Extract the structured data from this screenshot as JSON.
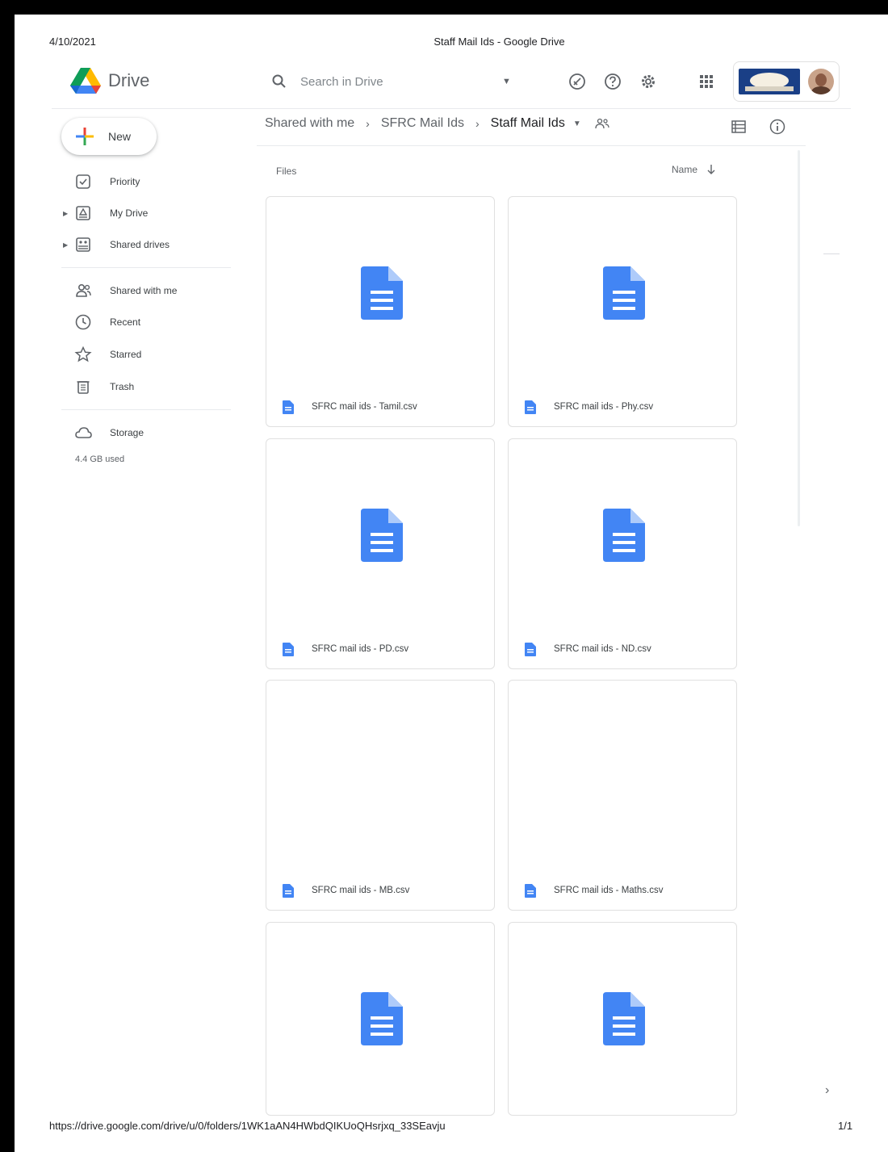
{
  "print": {
    "date": "4/10/2021",
    "title": "Staff Mail Ids - Google Drive",
    "url": "https://drive.google.com/drive/u/0/folders/1WK1aAN4HWbdQIKUoQHsrjxq_33SEavju",
    "page": "1/1"
  },
  "app": {
    "name": "Drive"
  },
  "search": {
    "placeholder": "Search in Drive"
  },
  "new_button": {
    "label": "New"
  },
  "sidebar": {
    "items": [
      {
        "label": "Priority",
        "icon": "priority-checkbox-icon"
      },
      {
        "label": "My Drive",
        "icon": "my-drive-icon"
      },
      {
        "label": "Shared drives",
        "icon": "shared-drives-icon"
      },
      {
        "label": "Shared with me",
        "icon": "shared-with-me-icon"
      },
      {
        "label": "Recent",
        "icon": "clock-icon"
      },
      {
        "label": "Starred",
        "icon": "star-icon"
      },
      {
        "label": "Trash",
        "icon": "trash-icon"
      },
      {
        "label": "Storage",
        "icon": "cloud-icon"
      }
    ],
    "storage_used": "4.4 GB used"
  },
  "breadcrumb": [
    "Shared with me",
    "SFRC Mail Ids",
    "Staff Mail Ids"
  ],
  "files_header": {
    "label": "Files",
    "sort_label": "Name"
  },
  "files": [
    {
      "name": "SFRC mail ids - Tamil.csv",
      "has_thumb": true
    },
    {
      "name": "SFRC mail ids - Phy.csv",
      "has_thumb": true
    },
    {
      "name": "SFRC mail ids - PD.csv",
      "has_thumb": true
    },
    {
      "name": "SFRC mail ids - ND.csv",
      "has_thumb": true
    },
    {
      "name": "SFRC mail ids - MB.csv",
      "has_thumb": false
    },
    {
      "name": "SFRC mail ids - Maths.csv",
      "has_thumb": false
    },
    {
      "name": "",
      "has_thumb": true
    },
    {
      "name": "",
      "has_thumb": true
    }
  ],
  "colors": {
    "doc_blue": "#4285f4",
    "text": "#3c4043",
    "muted": "#5f6368"
  }
}
